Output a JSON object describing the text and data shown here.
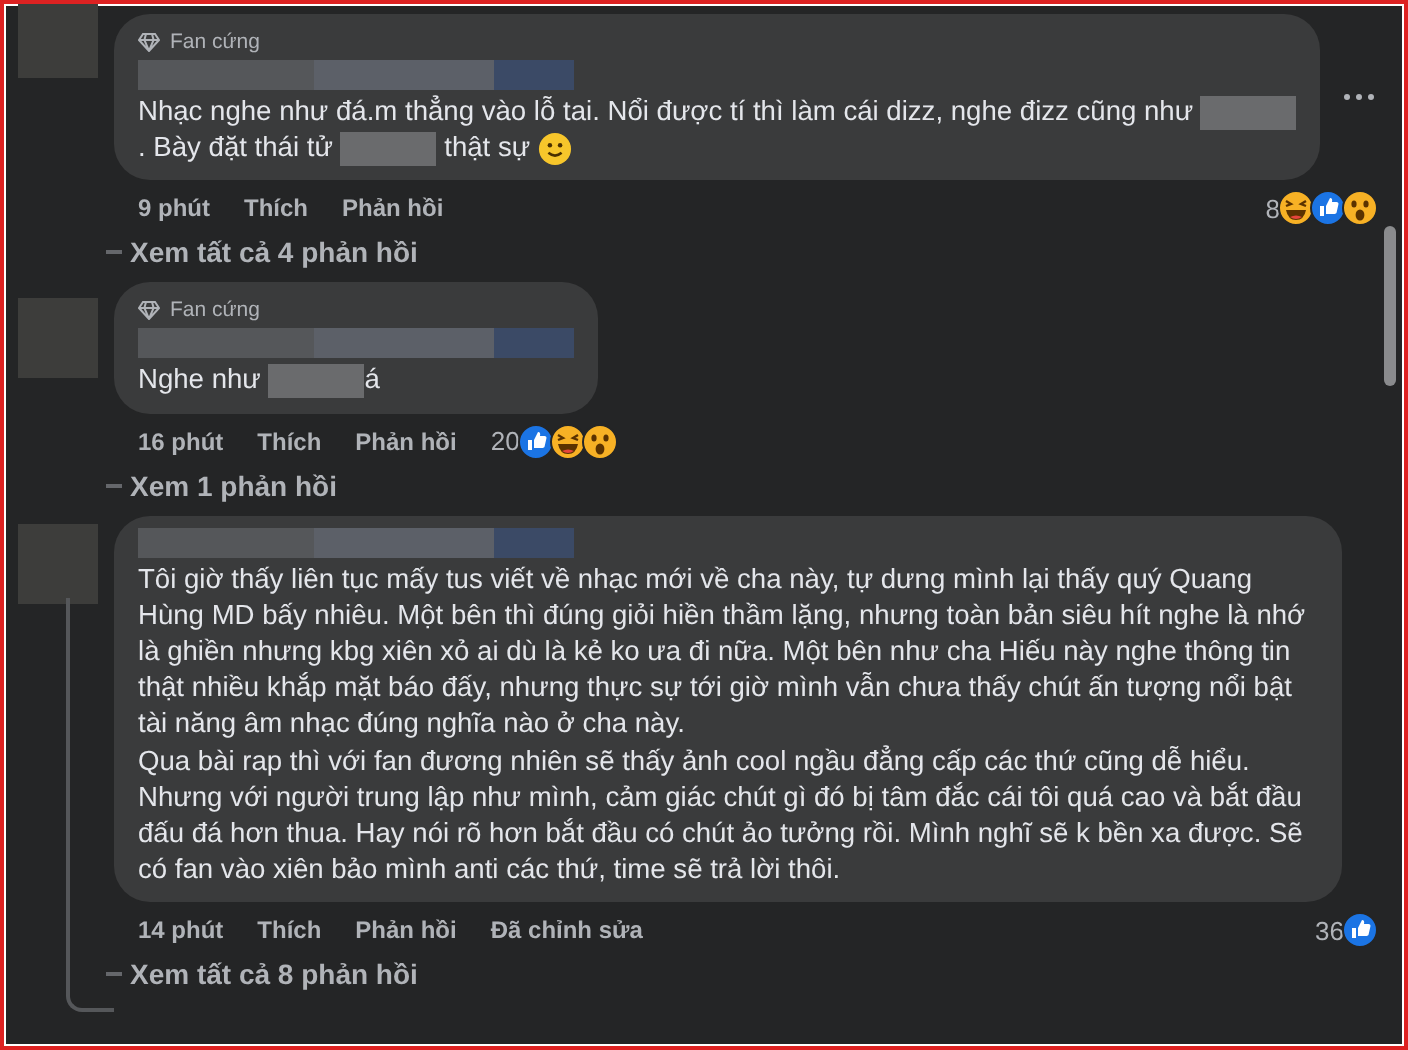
{
  "comments": [
    {
      "badge": "Fan cứng",
      "body": [
        [
          {
            "kind": "text",
            "text": "Nhạc nghe như đá.m thẳng vào lỗ tai. Nổi được tí thì làm cái dizz, nghe đizz cũng như "
          },
          {
            "kind": "redacted"
          }
        ],
        [
          {
            "kind": "text",
            "text": ". Bày đặt thái tử "
          },
          {
            "kind": "redacted"
          },
          {
            "kind": "text",
            "text": " thật sự "
          },
          {
            "kind": "emoji"
          }
        ]
      ],
      "time": "9 phút",
      "like": "Thích",
      "reply": "Phản hồi",
      "reaction_count": "8",
      "reactions": [
        {
          "kind": "haha"
        },
        {
          "kind": "like"
        },
        {
          "kind": "wow"
        }
      ],
      "replies_link": "Xem tất cả 4 phản hồi",
      "has_menu": true
    },
    {
      "badge": "Fan cứng",
      "body": [
        [
          {
            "kind": "text",
            "text": "Nghe như "
          },
          {
            "kind": "redacted"
          },
          {
            "kind": "text",
            "text": "á"
          }
        ]
      ],
      "time": "16 phút",
      "like": "Thích",
      "reply": "Phản hồi",
      "reaction_count": "20",
      "reactions": [
        {
          "kind": "like"
        },
        {
          "kind": "haha"
        },
        {
          "kind": "wow"
        }
      ],
      "replies_link": "Xem 1 phản hồi",
      "has_menu": false
    },
    {
      "body": [
        [
          {
            "kind": "text",
            "text": "Tôi giờ thấy liên tục mấy tus viết về nhạc mới về cha này, tự dưng mình lại thấy quý Quang Hùng MD bấy nhiêu. Một bên thì đúng giỏi hiền thầm lặng, nhưng toàn bản siêu hít nghe là nhớ là ghiền nhưng kbg xiên xỏ ai dù là kẻ ko ưa đi nữa. Một bên như cha Hiếu này nghe thông tin thật nhiều khắp mặt báo đấy, nhưng thực sự tới giờ mình vẫn chưa thấy chút ấn tượng nổi bật tài năng âm nhạc đúng nghĩa nào ở cha này."
          }
        ],
        [
          {
            "kind": "text",
            "text": "Qua bài rap thì với fan đương nhiên sẽ thấy ảnh cool ngầu đẳng cấp các thứ cũng dễ hiểu. Nhưng với người trung lập như mình, cảm giác chút gì đó bị tâm đắc cái tôi quá cao và bắt đầu đấu đá hơn thua. Hay nói rõ hơn bắt đầu có chút ảo tưởng rồi. Mình nghĩ sẽ k bền xa được. Sẽ có fan vào xiên bảo mình anti các thứ, time sẽ trả lời thôi."
          }
        ]
      ],
      "time": "14 phút",
      "like": "Thích",
      "reply": "Phản hồi",
      "edited": "Đã chỉnh sửa",
      "reaction_count": "36",
      "reactions": [
        {
          "kind": "like"
        }
      ],
      "replies_link": "Xem tất cả 8 phản hồi",
      "has_menu": false
    }
  ]
}
